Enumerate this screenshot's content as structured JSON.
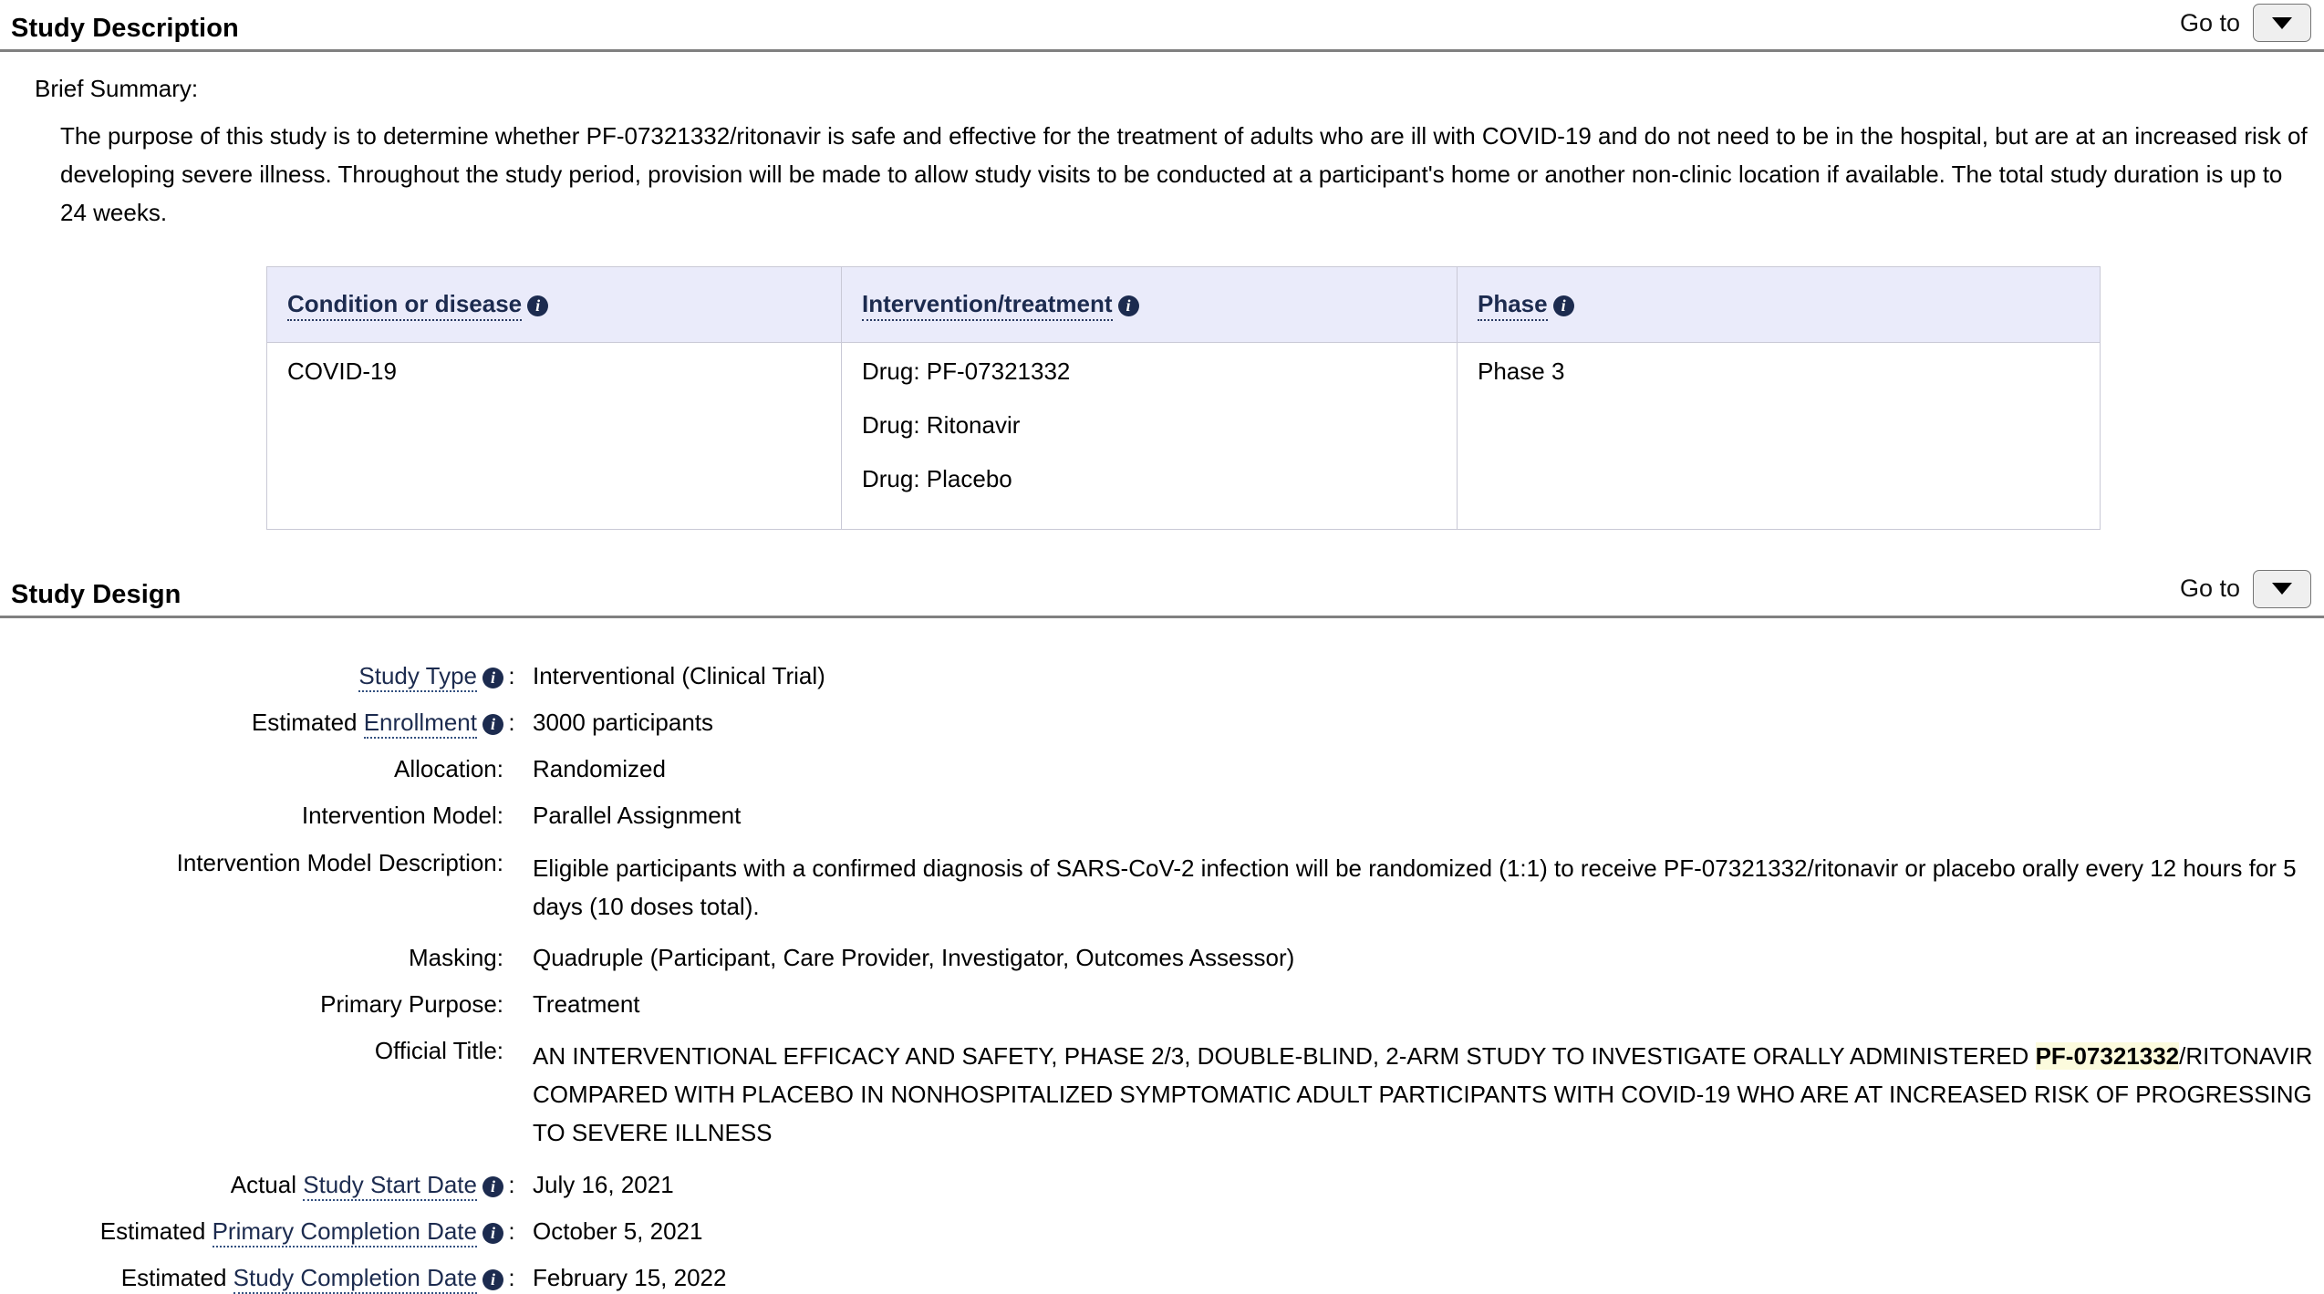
{
  "sections": {
    "study_description": {
      "title": "Study Description",
      "goto_label": "Go to",
      "goto_icon": "chevron-down-icon",
      "brief_summary_label": "Brief Summary:",
      "brief_summary_text": "The purpose of this study is to determine whether PF-07321332/ritonavir is safe and effective for the treatment of adults who are ill with COVID-19 and do not need to be in the hospital, but are at an increased risk of developing severe illness. Throughout the study period, provision will be made to allow study visits to be conducted at a participant's home or another non-clinic location if available. The total study duration is up to 24 weeks."
    },
    "study_design": {
      "title": "Study Design",
      "goto_label": "Go to",
      "goto_icon": "chevron-down-icon"
    }
  },
  "conditions_table": {
    "headers": [
      {
        "label": "Condition or disease",
        "icon": "info-icon"
      },
      {
        "label": "Intervention/treatment",
        "icon": "info-icon"
      },
      {
        "label": "Phase",
        "icon": "info-icon"
      }
    ],
    "row": {
      "condition": [
        "COVID-19"
      ],
      "interventions": [
        "Drug: PF-07321332",
        "Drug: Ritonavir",
        "Drug: Placebo"
      ],
      "phase": [
        "Phase 3"
      ]
    }
  },
  "design_rows": [
    {
      "prefix": "",
      "link": "Study Type",
      "icon": "info-icon",
      "suffix": "",
      "colon": ":",
      "value": "Interventional  (Clinical Trial)"
    },
    {
      "prefix": "Estimated ",
      "link": "Enrollment",
      "icon": "info-icon",
      "suffix": "",
      "colon": ":",
      "value": "3000 participants"
    },
    {
      "prefix": "",
      "link": "",
      "icon": "",
      "suffix": "Allocation:",
      "colon": "",
      "value": "Randomized"
    },
    {
      "prefix": "",
      "link": "",
      "icon": "",
      "suffix": "Intervention Model:",
      "colon": "",
      "value": "Parallel Assignment"
    },
    {
      "prefix": "",
      "link": "",
      "icon": "",
      "suffix": "Intervention Model Description:",
      "colon": "",
      "value": "Eligible participants with a confirmed diagnosis of SARS-CoV-2 infection will be randomized (1:1) to receive PF-07321332/ritonavir or placebo orally every 12 hours for 5 days (10 doses total)."
    },
    {
      "prefix": "",
      "link": "",
      "icon": "",
      "suffix": "Masking:",
      "colon": "",
      "value": "Quadruple (Participant, Care Provider, Investigator, Outcomes Assessor)"
    },
    {
      "prefix": "",
      "link": "",
      "icon": "",
      "suffix": "Primary Purpose:",
      "colon": "",
      "value": "Treatment"
    },
    {
      "prefix": "",
      "link": "",
      "icon": "",
      "suffix": "Actual Study Start Date",
      "colon": ":",
      "value": "July 16, 2021"
    },
    {
      "prefix": "Estimated ",
      "link": "Primary Completion Date",
      "icon": "info-icon",
      "suffix": "",
      "colon": ":",
      "value": "October 5, 2021"
    },
    {
      "prefix": "Estimated ",
      "link": "Study Completion Date",
      "icon": "info-icon",
      "suffix": "",
      "colon": ":",
      "value": "February 15, 2022"
    }
  ],
  "official_title": {
    "label": "Official Title:",
    "part1": "AN INTERVENTIONAL EFFICACY AND SAFETY, PHASE 2/3, DOUBLE-BLIND, 2-ARM STUDY TO INVESTIGATE ORALLY ADMINISTERED ",
    "highlight": "PF-07321332",
    "part2": "/RITONAVIR COMPARED WITH PLACEBO IN NONHOSPITALIZED SYMPTOMATIC ADULT PARTICIPANTS WITH COVID-19 WHO ARE AT INCREASED RISK OF PROGRESSING TO SEVERE ILLNESS"
  },
  "dates": {
    "start_prefix": "Actual ",
    "start_link": "Study Start Date",
    "start_value": "July 16, 2021",
    "primary_prefix": "Estimated ",
    "primary_link": "Primary Completion Date",
    "primary_value": "October 5, 2021",
    "completion_prefix": "Estimated ",
    "completion_link": "Study Completion Date",
    "completion_value": "February 15, 2022"
  },
  "colors": {
    "link_navy": "#1c2b4f",
    "header_bg": "#eaebfa",
    "highlight": "#fcfbdd",
    "rule": "#808080"
  },
  "icon_glyphs": {
    "info": "i"
  }
}
